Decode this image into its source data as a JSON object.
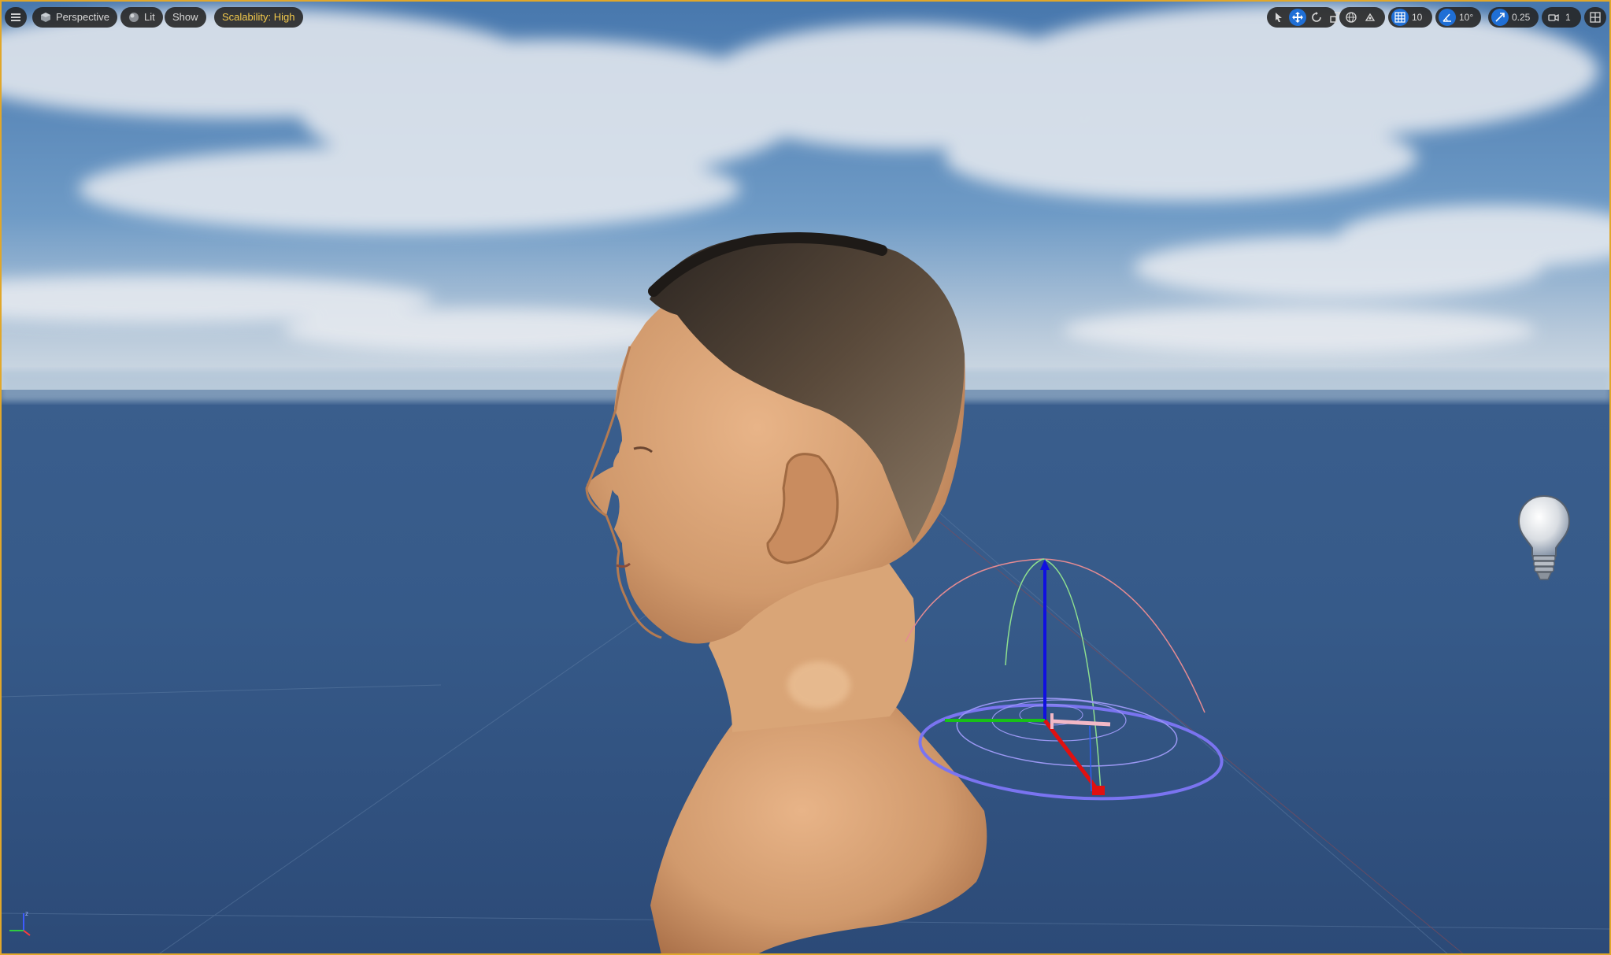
{
  "toolbar": {
    "menu_icon": "hamburger-menu-icon",
    "view_mode": {
      "label": "Perspective",
      "icon": "perspective-cube-icon"
    },
    "lighting_mode": {
      "label": "Lit",
      "icon": "lit-sphere-icon"
    },
    "show_label": "Show",
    "scalability_label": "Scalability: High",
    "transform_tools": [
      {
        "name": "select",
        "icon": "select-arrow-icon",
        "active": false
      },
      {
        "name": "translate",
        "icon": "translate-arrows-icon",
        "active": true
      },
      {
        "name": "rotate",
        "icon": "rotate-icon",
        "active": false
      },
      {
        "name": "scale",
        "icon": "scale-icon",
        "active": false
      }
    ],
    "world_local_icon": "globe-icon",
    "surface_snap_icon": "surface-snap-icon",
    "grid_snap": {
      "icon": "grid-snap-icon",
      "value": "10",
      "active": true
    },
    "rotation_snap": {
      "icon": "angle-snap-icon",
      "value": "10°",
      "active": true
    },
    "scale_snap": {
      "icon": "scale-snap-icon",
      "value": "0.25",
      "active": true
    },
    "camera_speed": {
      "icon": "camera-icon",
      "value": "1"
    },
    "layout_icon": "viewport-layout-icon"
  },
  "colors": {
    "accent_blue": "#1f6fd6",
    "scalability_text": "#f2c94c",
    "frame": "#e1a72a",
    "gizmo_x": "#e01010",
    "gizmo_y": "#18c018",
    "gizmo_z": "#1010e0"
  },
  "scene": {
    "subject": "human-head-bust",
    "light_actor_icon": "point-light-bulb-icon",
    "gizmo": "directional-light-gizmo",
    "axis_indicator_icon": "world-axis-icon"
  }
}
